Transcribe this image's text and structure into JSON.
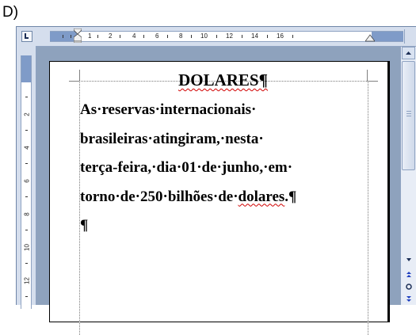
{
  "question_label": "D)",
  "ruler": {
    "horizontal_numbers": [
      "1",
      "2",
      "4",
      "6",
      "8",
      "10",
      "12",
      "14",
      "16"
    ],
    "vertical_numbers": [
      "2",
      "4",
      "6",
      "8",
      "10",
      "12"
    ]
  },
  "document": {
    "title": "DOLARES¶",
    "lines": [
      "As·reservas·internacionais·",
      "brasileiras·atingiram,·nesta·",
      "terça-feira,·dia·01·de·junho,·em·",
      "torno·de·250·bilhões·de·dolares.¶",
      "¶"
    ]
  },
  "icons": {
    "tab_selector": "left-tab-icon",
    "scroll_up": "scroll-up-arrow-icon",
    "scroll_down": "scroll-down-arrow-icon",
    "prev_page": "previous-page-icon",
    "browse_object": "browse-object-icon",
    "next_page": "next-page-icon"
  },
  "colors": {
    "ruler_margin": "#7f9bc8",
    "workspace": "#8ea2bd",
    "spell_underline": "#d00000"
  }
}
